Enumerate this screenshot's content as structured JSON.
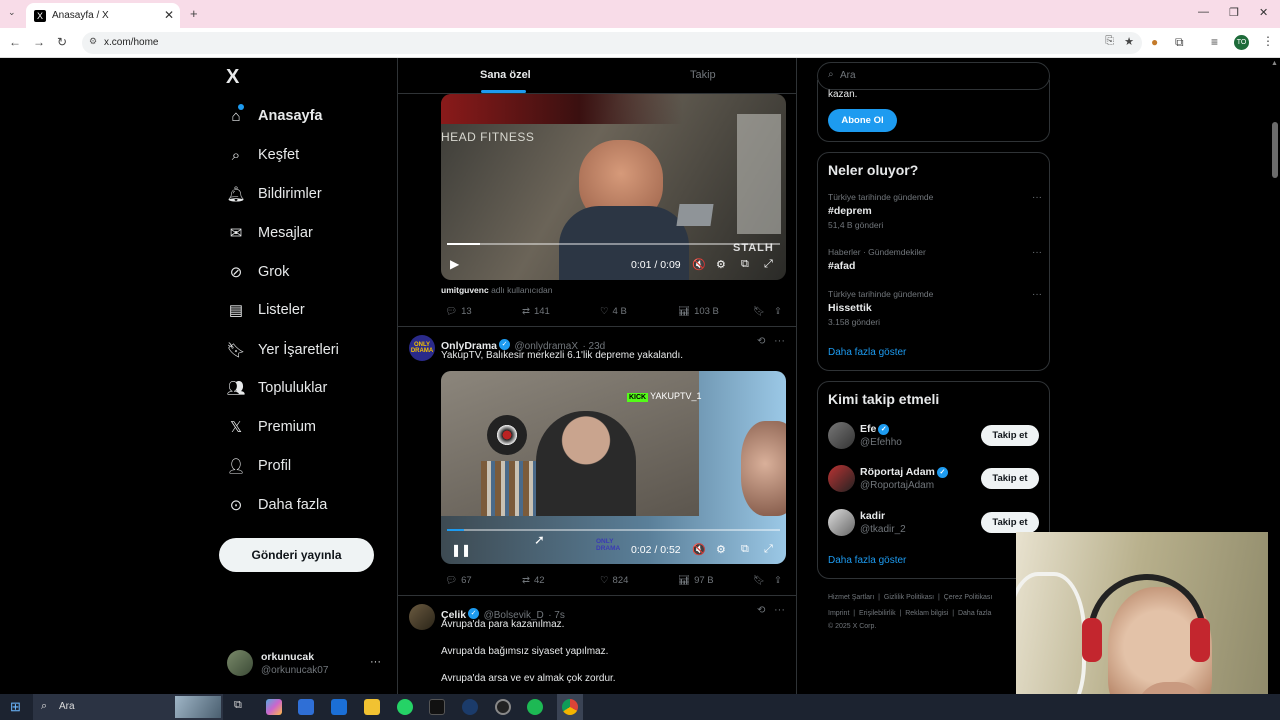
{
  "browser": {
    "tab_title": "Anasayfa / X",
    "tab_favicon": "X",
    "url": "x.com/home",
    "profile_initials": "TO"
  },
  "nav": {
    "logo": "X",
    "items": [
      {
        "label": "Anasayfa",
        "icon": "home-icon"
      },
      {
        "label": "Keşfet",
        "icon": "search-icon"
      },
      {
        "label": "Bildirimler",
        "icon": "bell-icon"
      },
      {
        "label": "Mesajlar",
        "icon": "mail-icon"
      },
      {
        "label": "Grok",
        "icon": "grok-icon"
      },
      {
        "label": "Listeler",
        "icon": "list-icon"
      },
      {
        "label": "Yer İşaretleri",
        "icon": "bookmark-icon"
      },
      {
        "label": "Topluluklar",
        "icon": "people-icon"
      },
      {
        "label": "Premium",
        "icon": "x-icon"
      },
      {
        "label": "Profil",
        "icon": "person-icon"
      },
      {
        "label": "Daha fazla",
        "icon": "more-circle-icon"
      }
    ],
    "post_button": "Gönderi yayınla",
    "account": {
      "name": "orkunucak",
      "handle": "@orkunucak07",
      "more": "···"
    }
  },
  "feed": {
    "tabs": [
      "Sana özel",
      "Takip"
    ],
    "tweet1": {
      "video_text": "HEAD FITNESS",
      "video_brand": "STALH",
      "time": "0:01 / 0:09",
      "caption_user": "umitguvenc",
      "caption_suffix": "adlı kullanıcıdan",
      "stats": {
        "replies": "13",
        "reposts": "141",
        "likes": "4 B",
        "views": "103 B"
      }
    },
    "tweet2": {
      "name": "OnlyDrama",
      "handle": "@onlydramaX",
      "time": "· 23d",
      "avatar_text": "ONLY DRAMA",
      "text": "YakupTV, Balıkesir merkezli 6.1'lik depreme yakalandı.",
      "stream_tag": "KICK",
      "stream_name": "YAKUPTV_1",
      "watermark": "ONLY DRAMA",
      "video_time": "0:02 / 0:52",
      "progress": 0.05,
      "stats": {
        "replies": "67",
        "reposts": "42",
        "likes": "824",
        "views": "97 B"
      }
    },
    "tweet3": {
      "name": "Çelik",
      "handle": "@Bolsevik_D",
      "time": "· 7s",
      "lines": [
        "Avrupa'da para kazanılmaz.",
        "Avrupa'da bağımsız siyaset yapılmaz.",
        "Avrupa'da arsa ve ev almak çok zordur."
      ]
    }
  },
  "sidebar": {
    "search_placeholder": "Ara",
    "premium": {
      "text_tail": "kazan.",
      "button": "Abone Ol"
    },
    "trends": {
      "title": "Neler oluyor?",
      "items": [
        {
          "category": "Türkiye tarihinde gündemde",
          "name": "#deprem",
          "count": "51,4 B gönderi"
        },
        {
          "category": "Haberler · Gündemdekiler",
          "name": "#afad",
          "count": ""
        },
        {
          "category": "Türkiye tarihinde gündemde",
          "name": "Hissettik",
          "count": "3.158 gönderi"
        }
      ],
      "more": "Daha fazla göster"
    },
    "who_to_follow": {
      "title": "Kimi takip etmeli",
      "users": [
        {
          "name": "Efe",
          "handle": "@Efehho",
          "verified": true,
          "button": "Takip et"
        },
        {
          "name": "Röportaj Adam",
          "handle": "@RoportajAdam",
          "verified": true,
          "button": "Takip et"
        },
        {
          "name": "kadir",
          "handle": "@tkadir_2",
          "verified": false,
          "button": "Takip et"
        }
      ],
      "more": "Daha fazla göster"
    },
    "footer": {
      "row1": [
        "Hizmet Şartları",
        "Gizlilik Politikası",
        "Çerez Politikası"
      ],
      "row2": [
        "Imprint",
        "Erişilebilirlik",
        "Reklam bilgisi",
        "Daha fazla"
      ],
      "copyright": "© 2025 X Corp."
    }
  },
  "taskbar": {
    "search": "Ara"
  },
  "colors": {
    "accent": "#1d9bf0",
    "background": "#000000",
    "border": "#2f3336",
    "muted": "#71767b"
  }
}
